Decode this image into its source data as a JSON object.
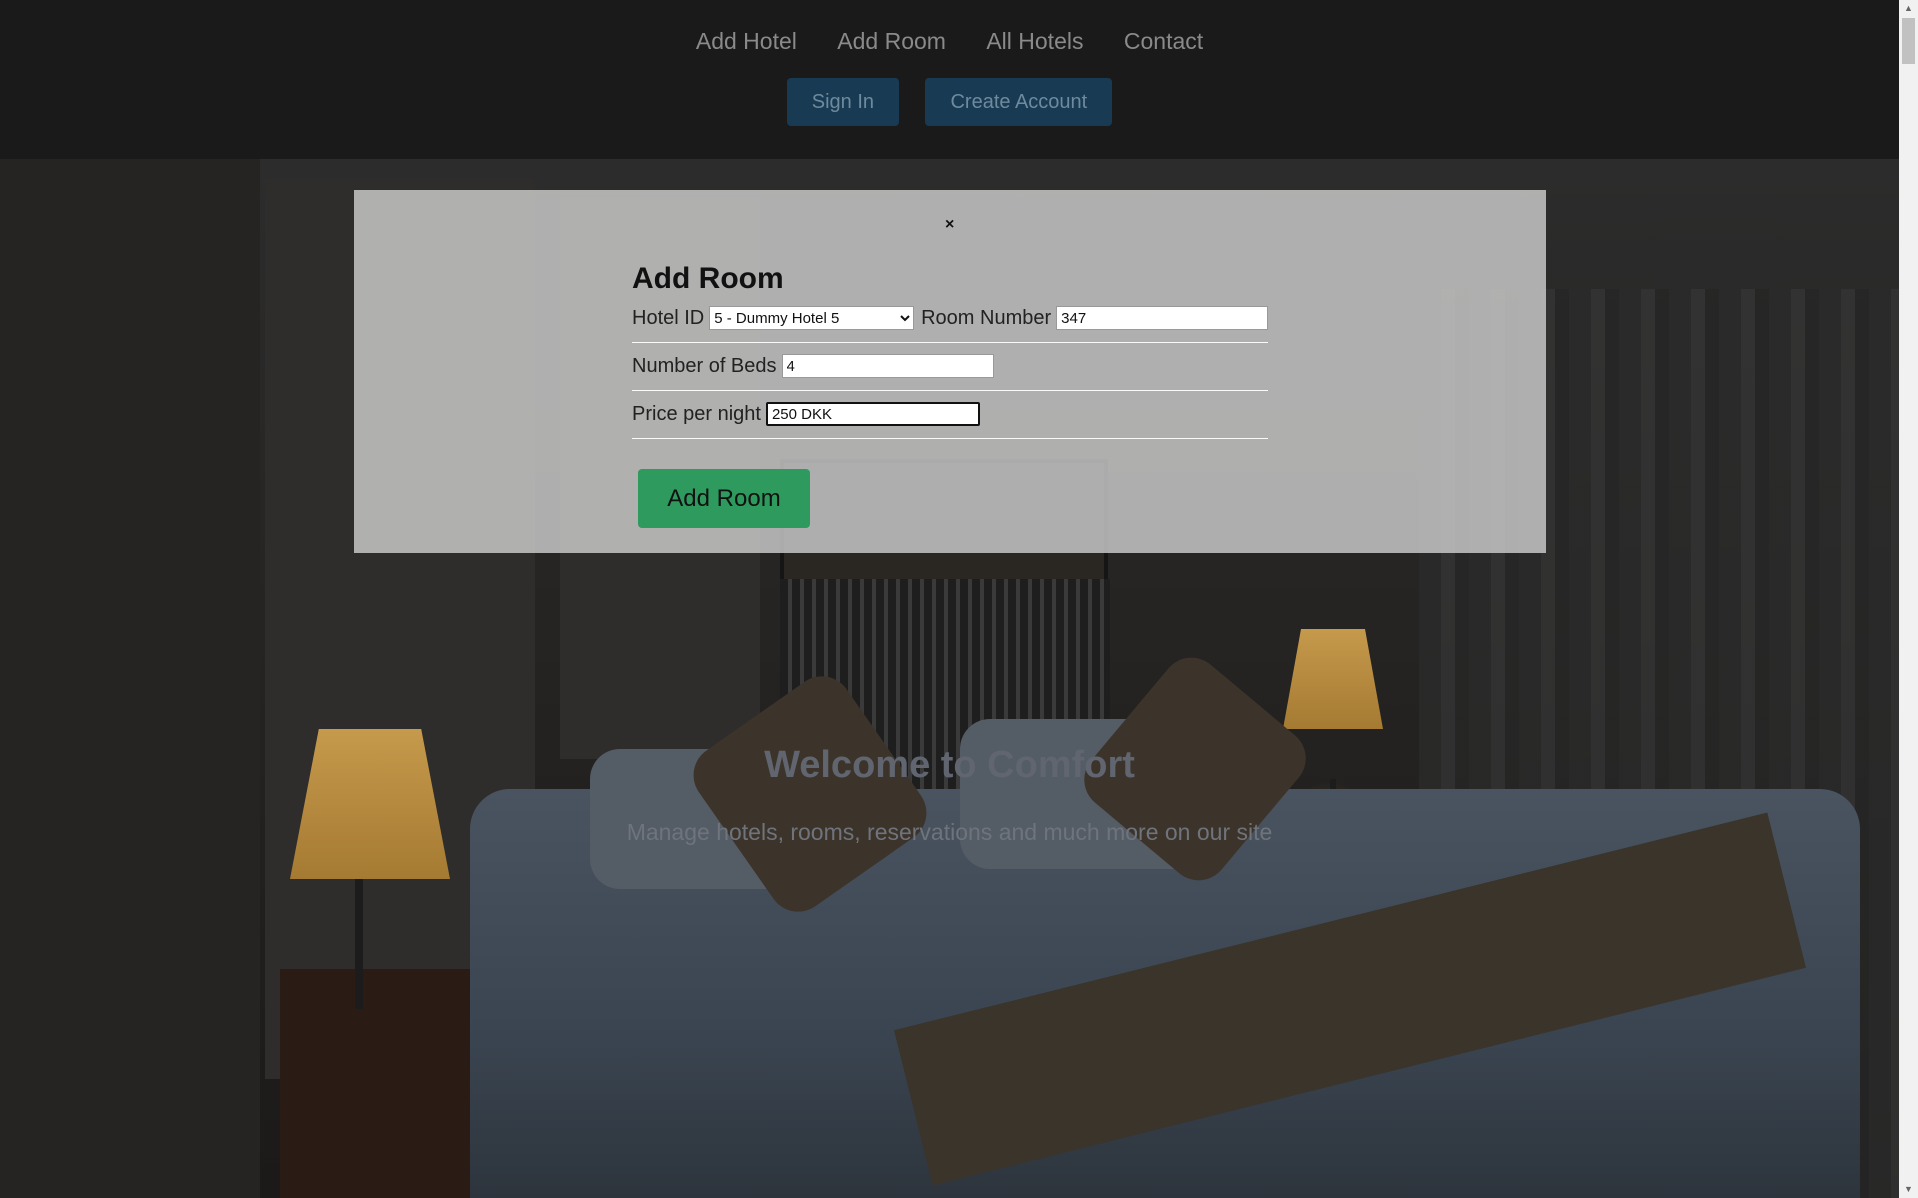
{
  "nav": {
    "links": [
      "Add Hotel",
      "Add Room",
      "All Hotels",
      "Contact"
    ],
    "sign_in": "Sign In",
    "create_account": "Create Account"
  },
  "hero": {
    "title": "Welcome to Comfort",
    "subtitle": "Manage hotels, rooms, reservations and much more on our site"
  },
  "modal": {
    "close": "×",
    "title": "Add Room",
    "hotel_id_label": "Hotel ID",
    "hotel_id_value": "5 - Dummy Hotel 5",
    "room_number_label": "Room Number",
    "room_number_value": "347",
    "beds_label": "Number of Beds",
    "beds_value": "4",
    "price_label": "Price per night",
    "price_value": "250 DKK",
    "submit": "Add Room"
  },
  "scrollbar": {
    "up_icon": "▲",
    "down_icon": "▼"
  }
}
